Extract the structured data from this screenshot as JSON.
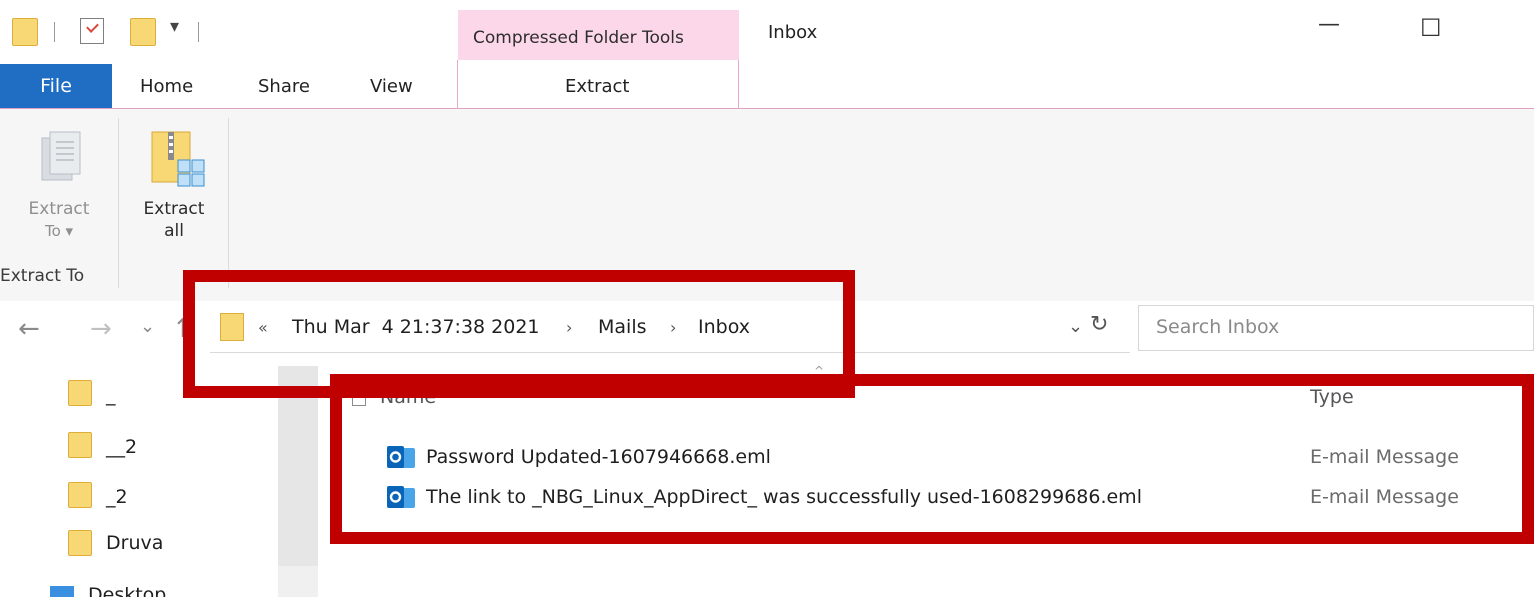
{
  "window": {
    "context_tab_group": "Compressed Folder Tools",
    "title": "Inbox",
    "minimize_glyph": "—",
    "maximize_glyph": "☐"
  },
  "quick_access_toolbar": {
    "dropdown_glyph": "▾"
  },
  "ribbon": {
    "tabs": [
      "File",
      "Home",
      "Share",
      "View",
      "Extract"
    ],
    "active_tab": "Extract",
    "buttons": {
      "extract_to_line1": "Extract",
      "extract_to_line2": "To ▾",
      "extract_all_line1": "Extract",
      "extract_all_line2": "all"
    },
    "group_label": "Extract To"
  },
  "navigation": {
    "back_glyph": "←",
    "forward_glyph": "→",
    "recent_glyph": "⌄",
    "up_glyph": "↑",
    "overflow_glyph": "«",
    "breadcrumb": [
      "Thu Mar  4 21:37:38 2021",
      "Mails",
      "Inbox"
    ],
    "crumb_sep": "›",
    "dropdown_glyph": "⌄",
    "refresh_glyph": "↻",
    "search_placeholder": "Search Inbox"
  },
  "nav_pane": {
    "folders": [
      "_",
      "__2",
      "_2",
      "Druva"
    ],
    "partial_item": "Desktop"
  },
  "file_list": {
    "columns": {
      "name": "Name",
      "type": "Type"
    },
    "rows": [
      {
        "name": "Password Updated-1607946668.eml",
        "type": "E-mail Message"
      },
      {
        "name": "The link to _NBG_Linux_AppDirect_ was successfully used-1608299686.eml",
        "type": "E-mail Message"
      }
    ]
  },
  "colors": {
    "highlight": "#c00000",
    "file_tab": "#1f6ec4",
    "context_tab": "#fcd7ea",
    "folder": "#f8d775"
  },
  "icons": {
    "folder": "folder-icon",
    "outlook": "outlook-message-icon",
    "extract_to": "extract-to-icon",
    "extract_all": "extract-all-zip-icon"
  }
}
